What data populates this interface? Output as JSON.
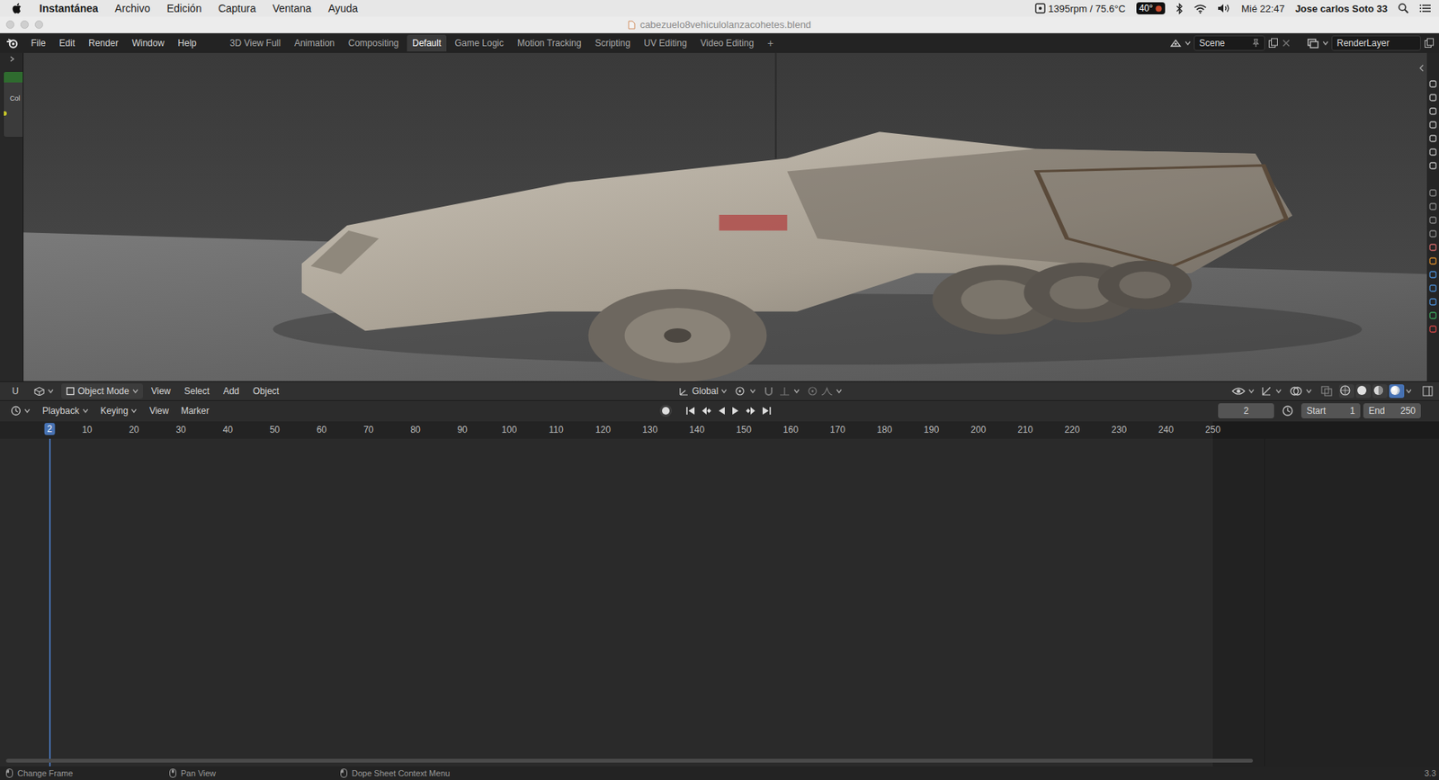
{
  "menubar": {
    "app": "Instantánea",
    "items": [
      "Archivo",
      "Edición",
      "Captura",
      "Ventana",
      "Ayuda"
    ],
    "fan": "1395rpm / 75.6°C",
    "temp_badge": "40°",
    "clock": "Mié 22:47",
    "user": "Jose carlos Soto 33"
  },
  "window": {
    "title": "cabezuelo8vehiculolanzacohetes.blend"
  },
  "topbar": {
    "menus": [
      "File",
      "Edit",
      "Render",
      "Window",
      "Help"
    ],
    "workspaces": [
      {
        "label": "3D View Full",
        "selected": false
      },
      {
        "label": "Animation",
        "selected": false
      },
      {
        "label": "Compositing",
        "selected": false
      },
      {
        "label": "Default",
        "selected": true
      },
      {
        "label": "Game Logic",
        "selected": false
      },
      {
        "label": "Motion Tracking",
        "selected": false
      },
      {
        "label": "Scripting",
        "selected": false
      },
      {
        "label": "UV Editing",
        "selected": false
      },
      {
        "label": "Video Editing",
        "selected": false
      }
    ],
    "add_tab": "+",
    "scene": "Scene",
    "render_layer": "RenderLayer"
  },
  "node_strip": {
    "label": "Col"
  },
  "viewport_header": {
    "editor_letter": "U",
    "mode": "Object Mode",
    "menus": [
      "View",
      "Select",
      "Add",
      "Object"
    ],
    "orientation": "Global",
    "shading": [
      {
        "kind": "wireframe",
        "selected": false
      },
      {
        "kind": "solid",
        "selected": false
      },
      {
        "kind": "material",
        "selected": false
      },
      {
        "kind": "rendered",
        "selected": true
      }
    ]
  },
  "timeline": {
    "menus": [
      "Playback",
      "Keying",
      "View",
      "Marker"
    ],
    "current_frame": "2",
    "start_label": "Start",
    "start": "1",
    "end_label": "End",
    "end": "250",
    "playhead": "2",
    "ticks": [
      "10",
      "20",
      "30",
      "40",
      "50",
      "60",
      "70",
      "80",
      "90",
      "100",
      "110",
      "120",
      "130",
      "140",
      "150",
      "160",
      "170",
      "180",
      "190",
      "200",
      "210",
      "220",
      "230",
      "240",
      "250"
    ]
  },
  "status_bar": {
    "items": [
      "Change Frame",
      "Pan View",
      "Dope Sheet Context Menu"
    ],
    "version": "3.3"
  }
}
